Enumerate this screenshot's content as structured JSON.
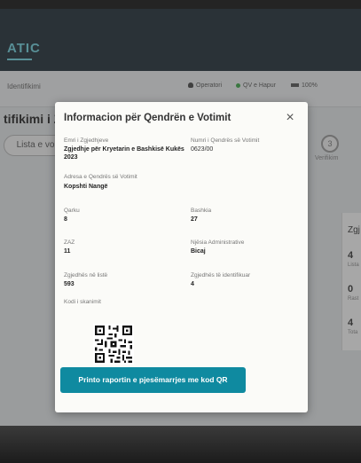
{
  "app": {
    "brand": "ATIC"
  },
  "status_bar": {
    "left_text": "Identifikimi",
    "operator": "Operatori",
    "qv": "QV e Hapur",
    "battery": "100%"
  },
  "page": {
    "title": "tifikimi i Zg",
    "list_tab": "Lista e vo",
    "step_number": "3",
    "step_label": "Verifikim"
  },
  "side_panel": {
    "header": "Zgj",
    "rows": [
      {
        "value": "4",
        "label": "Lista"
      },
      {
        "value": "0",
        "label": "Rast"
      },
      {
        "value": "4",
        "label": "Tota"
      }
    ]
  },
  "modal": {
    "title": "Informacion për Qendrën e Votimit",
    "close_symbol": "×",
    "fields": {
      "election_name_label": "Emri i Zgjedhjeve",
      "election_name_value": "Zgjedhje për Kryetarin e Bashkisë Kukës 2023",
      "center_number_label": "Numri i Qendrës së Votimit",
      "center_number_value": "0623/00",
      "address_label": "Adresa e Qendrës së Votimit",
      "address_value": "Kopshti Nangë",
      "qarku_label": "Qarku",
      "qarku_value": "8",
      "bashkia_label": "Bashkia",
      "bashkia_value": "27",
      "zaz_label": "ZAZ",
      "zaz_value": "11",
      "njesia_label": "Njësia Administrative",
      "njesia_value": "Bicaj",
      "listed_label": "Zgjedhës në listë",
      "listed_value": "593",
      "identified_label": "Zgjedhës të identifikuar",
      "identified_value": "4",
      "scan_label": "Kodi i skanimit"
    },
    "print_button": "Printo raportin e pjesëmarrjes me kod QR"
  }
}
